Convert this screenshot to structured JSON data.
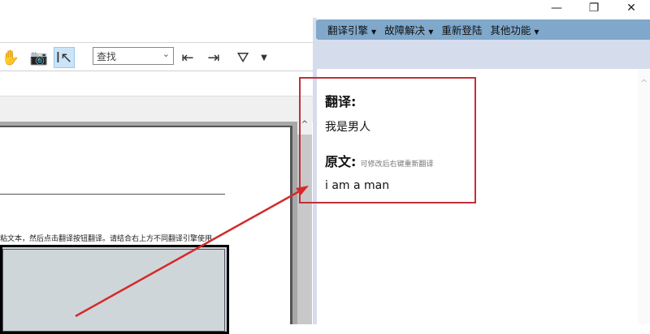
{
  "toolbar": {
    "find_placeholder": "查找"
  },
  "document": {
    "instruction_text": "粘文本，然后点击翻译按钮翻译。请结合右上方不同翻译引擎使用"
  },
  "window_controls": {
    "minimize": "—",
    "restore": "❐",
    "close": "✕"
  },
  "menu": [
    {
      "label": "翻译引擎",
      "has_dropdown": true
    },
    {
      "label": "故障解决",
      "has_dropdown": true
    },
    {
      "label": "重新登陆",
      "has_dropdown": false
    },
    {
      "label": "其他功能",
      "has_dropdown": true
    }
  ],
  "result": {
    "translation_label": "翻译:",
    "translation_text": "我是男人",
    "source_label": "原文:",
    "source_hint": "可修改后右键重新翻译",
    "source_text": "i am a man"
  },
  "colors": {
    "menubar": "#7fa8ca",
    "highlight_box": "#c0303a",
    "arrow": "#d42a2a"
  }
}
